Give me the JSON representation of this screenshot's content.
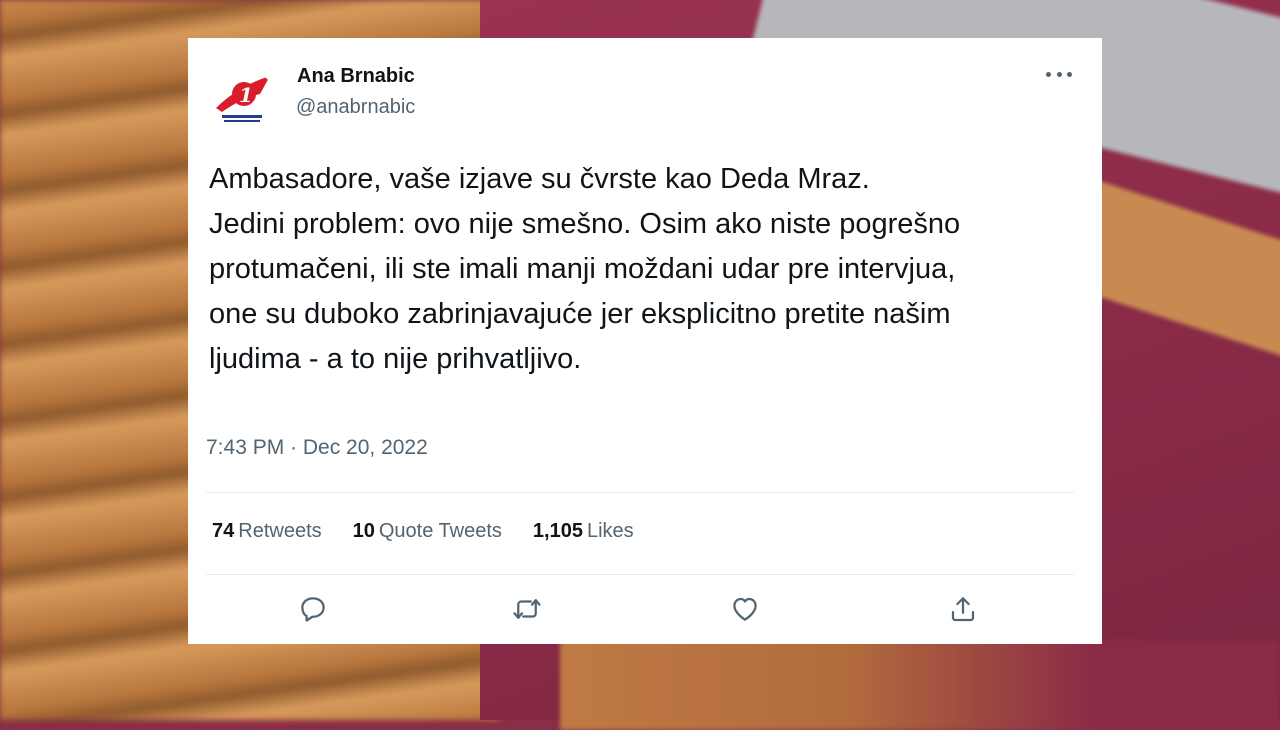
{
  "tweet": {
    "author": {
      "name": "Ana Brnabic",
      "handle": "@anabrnabic",
      "avatar_logo_glyph": "1"
    },
    "text": "Ambasadore, vaše izjave su čvrste kao Deda Mraz.\nJedini problem: ovo nije smešno. Osim ako niste pogrešno\nprotumačeni, ili ste imali manji moždani udar pre intervjua,\none su duboko zabrinjavajuće jer eksplicitno pretite našim\nljudima - a to nije prihvatljivo.",
    "timestamp": "7:43 PM · Dec 20, 2022",
    "stats": {
      "retweets": {
        "count": "74",
        "label": "Retweets"
      },
      "quote_tweets": {
        "count": "10",
        "label": "Quote Tweets"
      },
      "likes": {
        "count": "1,105",
        "label": "Likes"
      }
    },
    "actions": [
      "reply-icon",
      "retweet-icon",
      "like-icon",
      "share-icon"
    ]
  },
  "colors": {
    "text_primary": "#0f1419",
    "text_secondary": "#536471",
    "logo_red": "#d71f2b",
    "logo_blue": "#1f3f8f"
  }
}
